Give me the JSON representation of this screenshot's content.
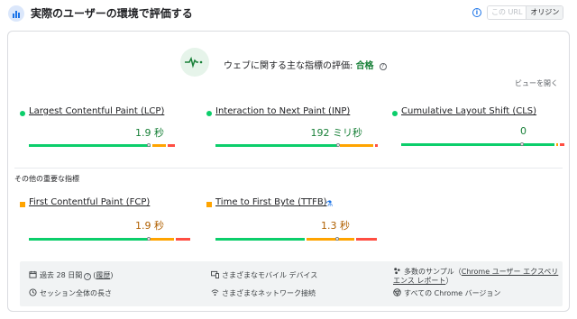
{
  "header": {
    "title": "実際のユーザーの環境で評価する",
    "toggle_url": "この URL",
    "toggle_origin": "オリジン"
  },
  "assessment": {
    "label": "ウェブに関する主な指標の評価:",
    "result": "合格",
    "view_link": "ビューを開く"
  },
  "core_metrics": [
    {
      "name": "Largest Contentful Paint (LCP)",
      "value": "1.9 秒",
      "status": "good"
    },
    {
      "name": "Interaction to Next Paint (INP)",
      "value": "192 ミリ秒",
      "status": "good"
    },
    {
      "name": "Cumulative Layout Shift (CLS)",
      "value": "0",
      "status": "good"
    }
  ],
  "other_title": "その他の重要な指標",
  "other_metrics": [
    {
      "name": "First Contentful Paint (FCP)",
      "value": "1.9 秒",
      "status": "needs-improvement"
    },
    {
      "name": "Time to First Byte (TTFB)",
      "value": "1.3 秒",
      "status": "needs-improvement"
    }
  ],
  "footer": {
    "period": "過去 28 日間",
    "history": "履歴",
    "session": "セッション全体の長さ",
    "mobile": "さまざまなモバイル デバイス",
    "network": "さまざまなネットワーク接続",
    "samples_prefix": "多数のサンプル（",
    "samples_link": "Chrome ユーザー エクスペリエンス レポート",
    "samples_suffix": "）",
    "versions": "すべての Chrome バージョン"
  },
  "colors": {
    "good": "#0cce6b",
    "average": "#ffa400",
    "poor": "#ff4e42",
    "accent": "#1a73e8"
  }
}
